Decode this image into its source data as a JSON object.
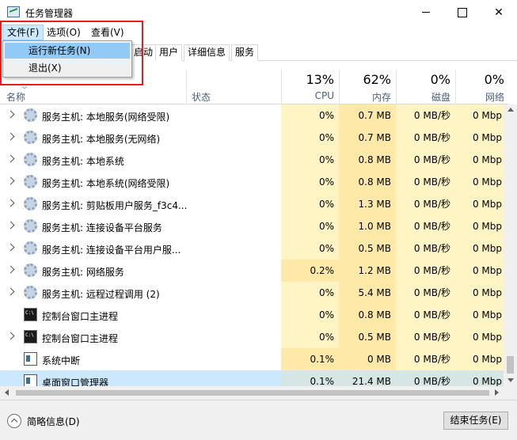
{
  "window": {
    "title": "任务管理器",
    "minimize_symbol": "",
    "maximize_symbol": "",
    "close_symbol": "✕"
  },
  "menubar": {
    "file": "文件(F)",
    "options": "选项(O)",
    "view": "查看(V)"
  },
  "file_menu": {
    "open": true,
    "items": [
      "运行新任务(N)",
      "退出(X)"
    ]
  },
  "tabs": [
    "启动",
    "用户",
    "详细信息",
    "服务"
  ],
  "columns": {
    "name": "名称",
    "status": "状态",
    "cpu": {
      "pct": "13%",
      "label": "CPU"
    },
    "memory": {
      "pct": "62%",
      "label": "内存"
    },
    "disk": {
      "pct": "0%",
      "label": "磁盘"
    },
    "network": {
      "pct": "0%",
      "label": "网络"
    }
  },
  "rows": [
    {
      "name": "服务主机: 本地服务(网络受限)",
      "icon": "gear-icon",
      "expandable": true,
      "cpu": "0%",
      "mem": "0.7 MB",
      "disk": "0 MB/秒",
      "net": "0 Mbp"
    },
    {
      "name": "服务主机: 本地服务(无网络)",
      "icon": "gear-icon",
      "expandable": true,
      "cpu": "0%",
      "mem": "0.7 MB",
      "disk": "0 MB/秒",
      "net": "0 Mbp"
    },
    {
      "name": "服务主机: 本地系统",
      "icon": "gear-icon",
      "expandable": true,
      "cpu": "0%",
      "mem": "0.8 MB",
      "disk": "0 MB/秒",
      "net": "0 Mbp"
    },
    {
      "name": "服务主机: 本地系统(网络受限)",
      "icon": "gear-icon",
      "expandable": true,
      "cpu": "0%",
      "mem": "0.8 MB",
      "disk": "0 MB/秒",
      "net": "0 Mbp"
    },
    {
      "name": "服务主机: 剪贴板用户服务_f3c4...",
      "icon": "gear-icon",
      "expandable": true,
      "cpu": "0%",
      "mem": "1.3 MB",
      "disk": "0 MB/秒",
      "net": "0 Mbp"
    },
    {
      "name": "服务主机: 连接设备平台服务",
      "icon": "gear-icon",
      "expandable": true,
      "cpu": "0%",
      "mem": "1.0 MB",
      "disk": "0 MB/秒",
      "net": "0 Mbp"
    },
    {
      "name": "服务主机: 连接设备平台用户服...",
      "icon": "gear-icon",
      "expandable": true,
      "cpu": "0%",
      "mem": "0.5 MB",
      "disk": "0 MB/秒",
      "net": "0 Mbp"
    },
    {
      "name": "服务主机: 网络服务",
      "icon": "gear-icon",
      "expandable": true,
      "cpu": "0.2%",
      "mem": "1.2 MB",
      "disk": "0 MB/秒",
      "net": "0 Mbp"
    },
    {
      "name": "服务主机: 远程过程调用 (2)",
      "icon": "gear-icon",
      "expandable": true,
      "cpu": "0%",
      "mem": "5.4 MB",
      "disk": "0 MB/秒",
      "net": "0 Mbp"
    },
    {
      "name": "控制台窗口主进程",
      "icon": "console-icon",
      "expandable": false,
      "cpu": "0%",
      "mem": "0.8 MB",
      "disk": "0 MB/秒",
      "net": "0 Mbp"
    },
    {
      "name": "控制台窗口主进程",
      "icon": "console-icon",
      "expandable": true,
      "cpu": "0%",
      "mem": "0.5 MB",
      "disk": "0 MB/秒",
      "net": "0 Mbp"
    },
    {
      "name": "系统中断",
      "icon": "window-icon",
      "expandable": false,
      "cpu": "0.1%",
      "mem": "0 MB",
      "disk": "0 MB/秒",
      "net": "0 Mbp"
    },
    {
      "name": "桌面窗口管理器",
      "icon": "window-icon",
      "expandable": false,
      "selected": true,
      "cpu": "0.1%",
      "mem": "21.4 MB",
      "disk": "0 MB/秒",
      "net": "0 Mbp"
    }
  ],
  "footer": {
    "fewer_details": "简略信息(D)",
    "end_task": "结束任务(E)"
  },
  "colors": {
    "heat_low": "#fff4c4",
    "heat_mid": "#ffe9a8",
    "selection": "#cce8ff",
    "menu_highlight": "#91c9f7",
    "annotation_box": "#e02020"
  }
}
